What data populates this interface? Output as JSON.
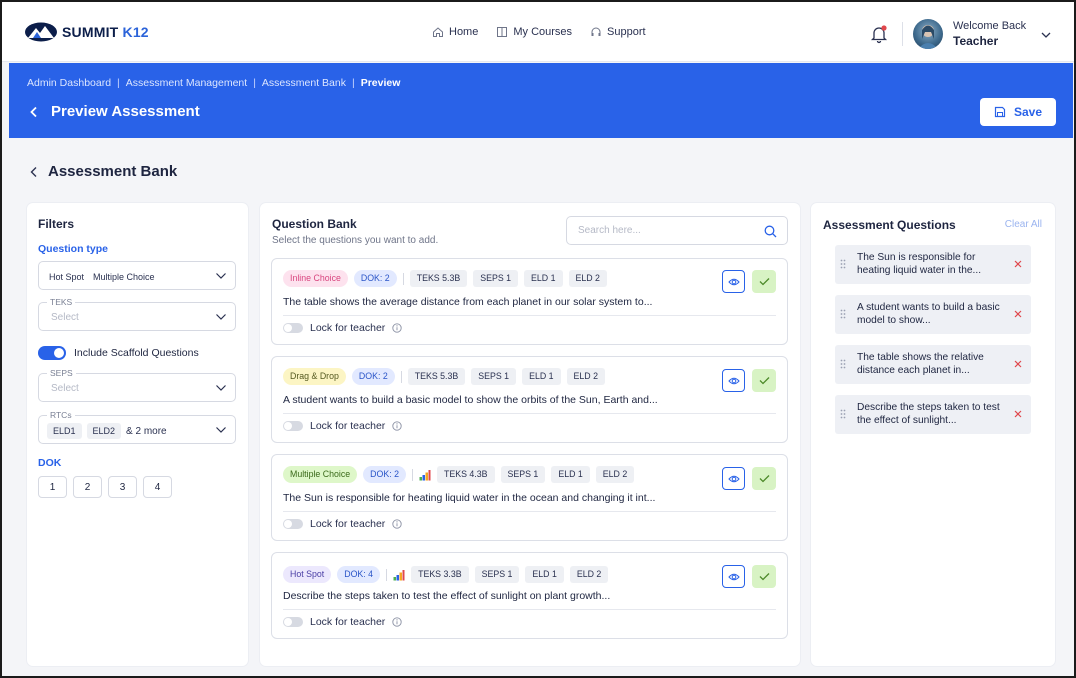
{
  "brand": {
    "name": "SUMMIT",
    "suffix": "K12"
  },
  "nav": {
    "links": [
      "Home",
      "My Courses",
      "Support"
    ]
  },
  "user": {
    "welcome": "Welcome Back",
    "role": "Teacher"
  },
  "breadcrumb": [
    "Admin Dashboard",
    "Assessment Management",
    "Assessment Bank",
    "Preview"
  ],
  "header": {
    "title": "Preview Assessment",
    "save_label": "Save"
  },
  "section_title": "Assessment Bank",
  "filters": {
    "title": "Filters",
    "question_type_label": "Question type",
    "question_type_chips": [
      "Hot Spot",
      "Multiple Choice"
    ],
    "teks_label": "TEKS",
    "teks_placeholder": "Select",
    "scaffold_label": "Include Scaffold Questions",
    "seps_label": "SEPS",
    "seps_placeholder": "Select",
    "rtcs_label": "RTCs",
    "rtcs_chips": [
      "ELD1",
      "ELD2"
    ],
    "rtcs_more": "& 2 more",
    "dok_label": "DOK",
    "dok_options": [
      "1",
      "2",
      "3",
      "4"
    ]
  },
  "question_bank": {
    "title": "Question Bank",
    "subtitle": "Select the questions you want to add.",
    "search_placeholder": "Search here...",
    "lock_label": "Lock for teacher",
    "questions": [
      {
        "type": "Inline Choice",
        "dok": "DOK: 2",
        "tags": [
          "TEKS 5.3B",
          "SEPS 1",
          "ELD 1",
          "ELD 2"
        ],
        "text": "The table shows the average distance from each planet in our solar system to..."
      },
      {
        "type": "Drag & Drop",
        "dok": "DOK: 2",
        "tags": [
          "TEKS 5.3B",
          "SEPS 1",
          "ELD 1",
          "ELD 2"
        ],
        "text": "A student wants to build a basic model to show the orbits of the Sun, Earth and..."
      },
      {
        "type": "Multiple Choice",
        "dok": "DOK: 2",
        "tags": [
          "TEKS 4.3B",
          "SEPS 1",
          "ELD 1",
          "ELD 2"
        ],
        "text": "The Sun is responsible for heating liquid water in the ocean and changing it int..."
      },
      {
        "type": "Hot Spot",
        "dok": "DOK: 4",
        "tags": [
          "TEKS 3.3B",
          "SEPS 1",
          "ELD 1",
          "ELD 2"
        ],
        "text": "Describe the steps taken to test the effect of sunlight on plant growth..."
      }
    ]
  },
  "assessment_questions": {
    "title": "Assessment Questions",
    "clear_all": "Clear All",
    "items": [
      "The Sun is responsible for heating liquid water in the...",
      "A student wants to build a basic model to show...",
      "The table shows the relative distance each planet in...",
      "Describe the steps taken to test the effect of sunlight..."
    ]
  },
  "colors": {
    "primary": "#2962e8",
    "remove": "#e0474c",
    "added": "#d8f3c4"
  }
}
